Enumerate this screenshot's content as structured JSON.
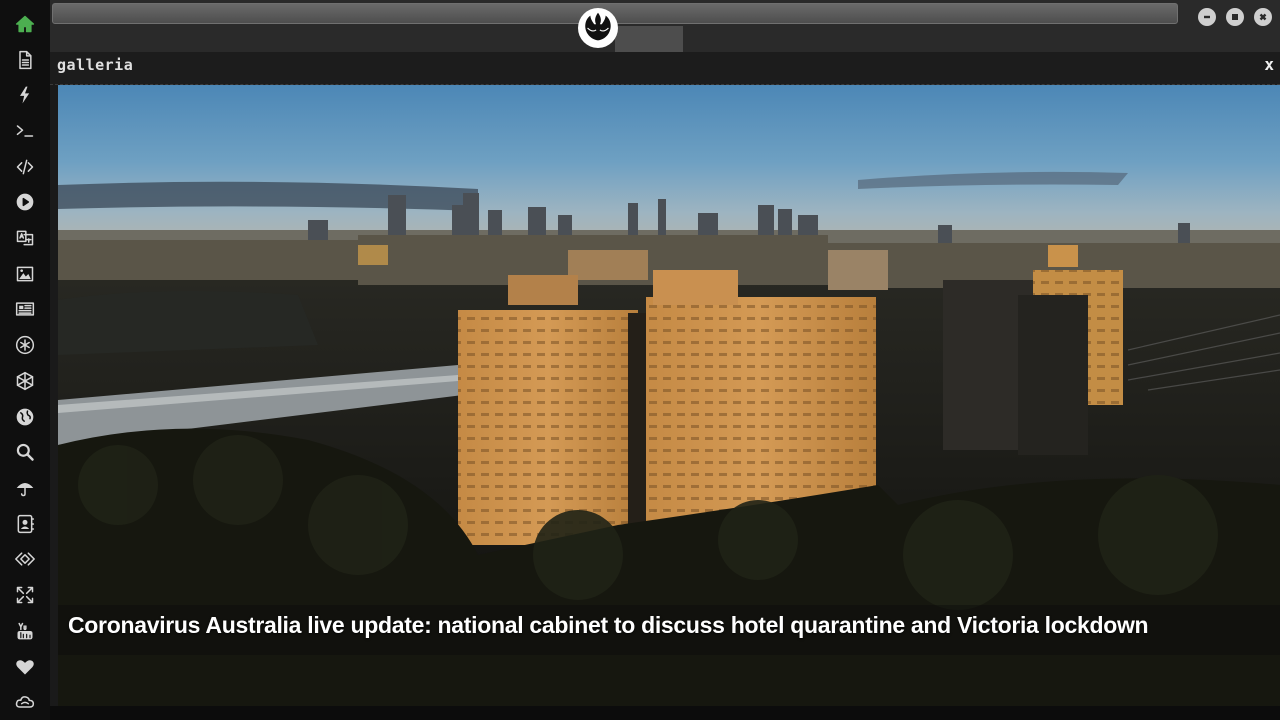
{
  "dock": {
    "items": [
      {
        "icon": "home-icon",
        "active": true
      },
      {
        "icon": "document-icon"
      },
      {
        "icon": "lightning-icon"
      },
      {
        "icon": "terminal-icon"
      },
      {
        "icon": "code-icon"
      },
      {
        "icon": "play-icon"
      },
      {
        "icon": "translate-icon"
      },
      {
        "icon": "image-icon"
      },
      {
        "icon": "newspaper-icon"
      },
      {
        "icon": "snowflake-icon"
      },
      {
        "icon": "network-icon"
      },
      {
        "icon": "globe-icon"
      },
      {
        "icon": "search-icon"
      },
      {
        "icon": "umbrella-icon"
      },
      {
        "icon": "contacts-icon"
      },
      {
        "icon": "dev-diamond-icon"
      },
      {
        "icon": "expand-icon"
      },
      {
        "icon": "youtube-icon"
      },
      {
        "icon": "heart-icon"
      },
      {
        "icon": "cloud-icon"
      }
    ]
  },
  "topbar": {
    "emblem_icon": "rebel-alliance-icon",
    "controls": [
      "minimize-icon",
      "maximize-icon",
      "close-icon"
    ]
  },
  "panel": {
    "title": "galleria",
    "close_label": "x"
  },
  "gallery": {
    "caption": "Coronavirus Australia live update: national cabinet to discuss hotel quarantine and Victoria lockdown"
  },
  "colors": {
    "accent": "#4caf50",
    "dock_bg": "#0f0f0f",
    "topbar_bg": "#2a2a2a",
    "panel_bg": "#1c1c1c"
  }
}
